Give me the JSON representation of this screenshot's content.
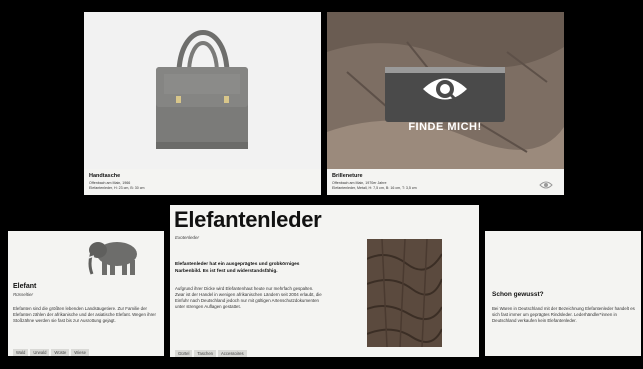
{
  "handbag": {
    "title": "Handtasche",
    "line1": "Offenbach am Main, 1966",
    "line2": "Elefantenleder, H: 23 cm, B: 30 cm"
  },
  "glasses": {
    "title": "Brilleneture",
    "line1": "Offenbach am Main, 1970er Jahre",
    "line2": "Elefantenleder, Metall, H: 7,5 cm, B: 16 cm, T: 3,5 cm",
    "overlay": "FINDE MICH!"
  },
  "elephant": {
    "title": "Elefant",
    "subtitle": "Rüsseltier",
    "body": "Elefanten sind die größten lebenden Landsäugetiere. Zur Familie der Elefanten zählen der afrikanische und der asiatische Elefant. Wegen ihrer Stoßzähne werden sie fast bis zur Ausrottung gejagt.",
    "tags": [
      "Wald",
      "Urwald",
      "Wüste",
      "Wiese"
    ]
  },
  "main": {
    "title": "Elefantenleder",
    "subtitle": "Exotenleder",
    "lead": "Elefantenleder hat ein ausgeprägtes und grobkörniges Narbenbild. Es ist fest und widerstandsfähig.",
    "body": "Aufgrund ihrer Dicke wird Elefantenhaut heute nur mehrfach gespalten. Zwar ist der Handel in wenigen afrikanischen Ländern seit 2004 erlaubt, die Einfuhr nach Deutschland jedoch nur mit gültigen Artenschutzdokumenten unter strengen Auflagen gestattet.",
    "tags": [
      "Gürtel",
      "Taschen",
      "Accessoires"
    ]
  },
  "didyouknow": {
    "title": "Schon gewusst?",
    "body": "Bei Waren in Deutschland mit der Bezeichnung Elefantenleder handelt es sich fast immer um geprägtes Rindsleder. Lederhändler*innen in Deutschland verkaufen kein Elefantenleder."
  },
  "colors": {
    "background": "#000000",
    "panel": "#f4f4f2",
    "tag": "#d9d9d6"
  },
  "icons": [
    "eye-search-icon",
    "eye-icon"
  ]
}
